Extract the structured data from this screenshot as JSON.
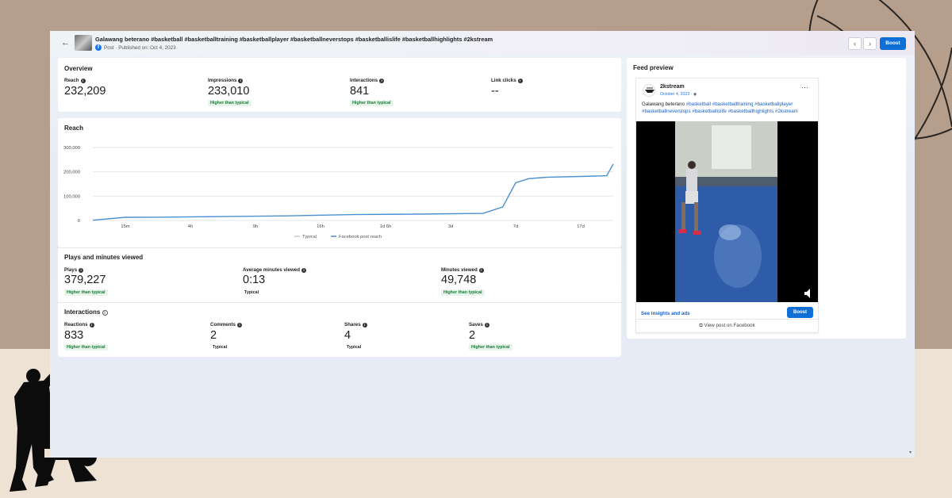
{
  "header": {
    "back_icon": "arrow-left-icon",
    "title": "Galawang beterano #basketball #basketballtraining #basketballplayer #basketballneverstops #basketballislife #basketballhighlights #2kstream",
    "subtitle": "Post · Published on: Oct 4, 2023",
    "prev_icon": "chevron-left-icon",
    "next_icon": "chevron-right-icon",
    "boost_label": "Boost"
  },
  "overview": {
    "title": "Overview",
    "metrics": [
      {
        "label": "Reach",
        "value": "232,209",
        "badge": ""
      },
      {
        "label": "Impressions",
        "value": "233,010",
        "badge": "Higher than typical"
      },
      {
        "label": "Interactions",
        "value": "841",
        "badge": "Higher than typical"
      },
      {
        "label": "Link clicks",
        "value": "--",
        "badge": ""
      }
    ]
  },
  "reach_chart": {
    "title": "Reach",
    "legend": [
      "Typical",
      "Facebook post reach"
    ]
  },
  "chart_data": {
    "type": "line",
    "title": "Reach",
    "xlabel": "",
    "ylabel": "",
    "x_ticks": [
      "15m",
      "4h",
      "9h",
      "16h",
      "1d 6h",
      "3d",
      "7d",
      "17d"
    ],
    "y_ticks": [
      "0",
      "100,000",
      "200,000",
      "300,000"
    ],
    "ylim": [
      0,
      300000
    ],
    "grid": true,
    "legend_position": "bottom",
    "series": [
      {
        "name": "Facebook post reach",
        "color": "#4a8fcf",
        "x": [
          0,
          0.5,
          1,
          2,
          3,
          4,
          5,
          6,
          6.3,
          6.5,
          6.7,
          6.9,
          7,
          7.5,
          7.9,
          8
        ],
        "y": [
          1000,
          13000,
          13500,
          16000,
          19000,
          24000,
          26000,
          29000,
          55000,
          155000,
          172000,
          176000,
          178000,
          181000,
          184000,
          232209
        ]
      },
      {
        "name": "Typical",
        "color": "#c8ccd2",
        "x": [],
        "y": []
      }
    ]
  },
  "plays": {
    "title": "Plays and minutes viewed",
    "metrics": [
      {
        "label": "Plays",
        "value": "379,227",
        "badge": "Higher than typical"
      },
      {
        "label": "Average minutes viewed",
        "value": "0:13",
        "badge": "Typical"
      },
      {
        "label": "Minutes viewed",
        "value": "49,748",
        "badge": "Higher than typical"
      }
    ]
  },
  "interactions": {
    "title": "Interactions",
    "metrics": [
      {
        "label": "Reactions",
        "value": "833",
        "badge": "Higher than typical"
      },
      {
        "label": "Comments",
        "value": "2",
        "badge": "Typical"
      },
      {
        "label": "Shares",
        "value": "4",
        "badge": "Typical"
      },
      {
        "label": "Saves",
        "value": "2",
        "badge": "Higher than typical"
      }
    ]
  },
  "feed_preview": {
    "title": "Feed preview",
    "page_name": "2kstream",
    "post_date": "October 4, 2023 · ",
    "more_icon": "more-horizontal-icon",
    "caption_text": "Galawang beterano",
    "hashtags": [
      "#basketball",
      "#basketballtraining",
      "#basketballplayer",
      "#basketballneverstops",
      "#basketballislife",
      "#basketballhighlights",
      "#2kstream"
    ],
    "see_insights": "See insights and ads",
    "boost_label": "Boost",
    "view_post": "View post on Facebook",
    "mute_icon": "volume-icon"
  },
  "colors": {
    "accent": "#0f6fd6",
    "badge_green": "#1a7a35",
    "link_blue": "#1a61c9"
  }
}
